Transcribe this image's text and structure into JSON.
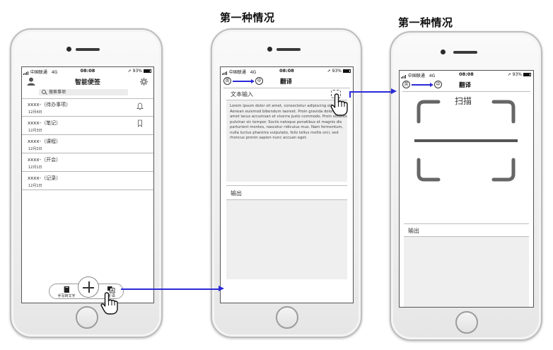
{
  "captions": {
    "scenario_a": "第一种情况",
    "scenario_b": "第一种情况"
  },
  "status_bar": {
    "carrier": "中国联通",
    "network": "4G",
    "time": "08:08",
    "battery": "93%"
  },
  "home_screen": {
    "title": "智能便签",
    "search_placeholder": "搜索事项",
    "notes": [
      {
        "title": "xxxx-（待办事项）",
        "date": "12月4日",
        "icon": "bell-icon"
      },
      {
        "title": "xxxx-（笔记）",
        "date": "12月3日",
        "icon": "bookmark-icon"
      },
      {
        "title": "xxxx-（课程）",
        "date": "12月2日",
        "icon": ""
      },
      {
        "title": "xxxx-（开会）",
        "date": "12月1日",
        "icon": ""
      },
      {
        "title": "xxxx-（记录）",
        "date": "12月1日",
        "icon": ""
      }
    ],
    "bottom_bar": {
      "handwriting_label": "手写转文字",
      "add_icon": "plus-icon",
      "translate_label": "翻 译"
    }
  },
  "translate_screen": {
    "source_lang": "英",
    "target_lang": "中",
    "title": "翻译",
    "input_label": "文本输入",
    "input_text": "Lorem ipsum dolor sit amet, consectetur adipiscing elit. Aenean euismod bibendum laoreet. Proin gravida dolor sit amet lacus accumsan et viverra justo commodo. Proin sodales pulvinar sic tempor. Sociis natoque penatibus et magnis dis parturient montes, nascetur ridiculus mus. Nam fermentum, nulla luctus pharetra vulputate, felis tellus mollis orci, sed rhoncus pronin sapien nunc accuan eget.",
    "output_label": "输出"
  },
  "scan_screen": {
    "source_lang": "英",
    "target_lang": "中",
    "title": "翻译",
    "scan_label": "扫描",
    "output_label": "输出"
  },
  "colors": {
    "connector": "#2a2ad8",
    "panel_gray": "#efefef"
  }
}
